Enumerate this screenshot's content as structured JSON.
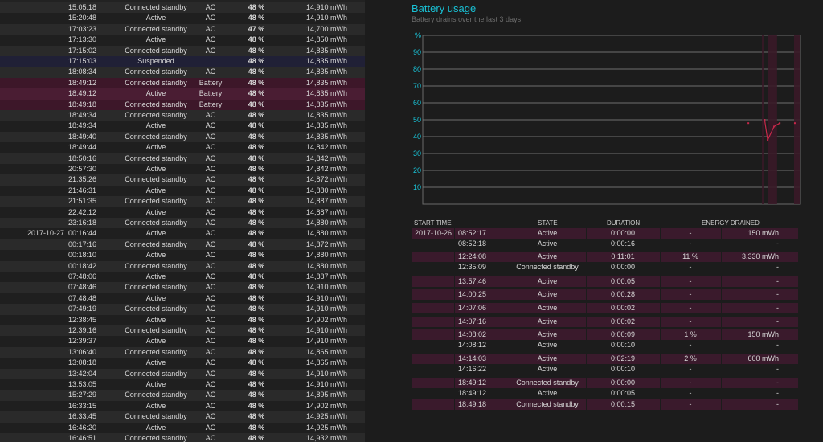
{
  "log": [
    {
      "date": "",
      "time": "15:05:18",
      "state": "Connected standby",
      "source": "AC",
      "pct": "48 %",
      "cap": "14,910 mWh"
    },
    {
      "date": "",
      "time": "15:20:48",
      "state": "Active",
      "source": "AC",
      "pct": "48 %",
      "cap": "14,910 mWh"
    },
    {
      "date": "",
      "time": "17:03:23",
      "state": "Connected standby",
      "source": "AC",
      "pct": "47 %",
      "cap": "14,700 mWh"
    },
    {
      "date": "",
      "time": "17:13:30",
      "state": "Active",
      "source": "AC",
      "pct": "48 %",
      "cap": "14,850 mWh"
    },
    {
      "date": "",
      "time": "17:15:02",
      "state": "Connected standby",
      "source": "AC",
      "pct": "48 %",
      "cap": "14,835 mWh"
    },
    {
      "date": "",
      "time": "17:15:03",
      "state": "Suspended",
      "source": "",
      "pct": "48 %",
      "cap": "14,835 mWh"
    },
    {
      "date": "",
      "time": "18:08:34",
      "state": "Connected standby",
      "source": "AC",
      "pct": "48 %",
      "cap": "14,835 mWh"
    },
    {
      "date": "",
      "time": "18:49:12",
      "state": "Connected standby",
      "source": "Battery",
      "pct": "48 %",
      "cap": "14,835 mWh"
    },
    {
      "date": "",
      "time": "18:49:12",
      "state": "Active",
      "source": "Battery",
      "pct": "48 %",
      "cap": "14,835 mWh"
    },
    {
      "date": "",
      "time": "18:49:18",
      "state": "Connected standby",
      "source": "Battery",
      "pct": "48 %",
      "cap": "14,835 mWh"
    },
    {
      "date": "",
      "time": "18:49:34",
      "state": "Connected standby",
      "source": "AC",
      "pct": "48 %",
      "cap": "14,835 mWh"
    },
    {
      "date": "",
      "time": "18:49:34",
      "state": "Active",
      "source": "AC",
      "pct": "48 %",
      "cap": "14,835 mWh"
    },
    {
      "date": "",
      "time": "18:49:40",
      "state": "Connected standby",
      "source": "AC",
      "pct": "48 %",
      "cap": "14,835 mWh"
    },
    {
      "date": "",
      "time": "18:49:44",
      "state": "Active",
      "source": "AC",
      "pct": "48 %",
      "cap": "14,842 mWh"
    },
    {
      "date": "",
      "time": "18:50:16",
      "state": "Connected standby",
      "source": "AC",
      "pct": "48 %",
      "cap": "14,842 mWh"
    },
    {
      "date": "",
      "time": "20:57:30",
      "state": "Active",
      "source": "AC",
      "pct": "48 %",
      "cap": "14,842 mWh"
    },
    {
      "date": "",
      "time": "21:35:26",
      "state": "Connected standby",
      "source": "AC",
      "pct": "48 %",
      "cap": "14,872 mWh"
    },
    {
      "date": "",
      "time": "21:46:31",
      "state": "Active",
      "source": "AC",
      "pct": "48 %",
      "cap": "14,880 mWh"
    },
    {
      "date": "",
      "time": "21:51:35",
      "state": "Connected standby",
      "source": "AC",
      "pct": "48 %",
      "cap": "14,887 mWh"
    },
    {
      "date": "",
      "time": "22:42:12",
      "state": "Active",
      "source": "AC",
      "pct": "48 %",
      "cap": "14,887 mWh"
    },
    {
      "date": "",
      "time": "23:16:18",
      "state": "Connected standby",
      "source": "AC",
      "pct": "48 %",
      "cap": "14,880 mWh"
    },
    {
      "date": "2017-10-27",
      "time": "00:16:44",
      "state": "Active",
      "source": "AC",
      "pct": "48 %",
      "cap": "14,880 mWh"
    },
    {
      "date": "",
      "time": "00:17:16",
      "state": "Connected standby",
      "source": "AC",
      "pct": "48 %",
      "cap": "14,872 mWh"
    },
    {
      "date": "",
      "time": "00:18:10",
      "state": "Active",
      "source": "AC",
      "pct": "48 %",
      "cap": "14,880 mWh"
    },
    {
      "date": "",
      "time": "00:18:42",
      "state": "Connected standby",
      "source": "AC",
      "pct": "48 %",
      "cap": "14,880 mWh"
    },
    {
      "date": "",
      "time": "07:48:06",
      "state": "Active",
      "source": "AC",
      "pct": "48 %",
      "cap": "14,887 mWh"
    },
    {
      "date": "",
      "time": "07:48:46",
      "state": "Connected standby",
      "source": "AC",
      "pct": "48 %",
      "cap": "14,910 mWh"
    },
    {
      "date": "",
      "time": "07:48:48",
      "state": "Active",
      "source": "AC",
      "pct": "48 %",
      "cap": "14,910 mWh"
    },
    {
      "date": "",
      "time": "07:49:19",
      "state": "Connected standby",
      "source": "AC",
      "pct": "48 %",
      "cap": "14,910 mWh"
    },
    {
      "date": "",
      "time": "12:38:45",
      "state": "Active",
      "source": "AC",
      "pct": "48 %",
      "cap": "14,902 mWh"
    },
    {
      "date": "",
      "time": "12:39:16",
      "state": "Connected standby",
      "source": "AC",
      "pct": "48 %",
      "cap": "14,910 mWh"
    },
    {
      "date": "",
      "time": "12:39:37",
      "state": "Active",
      "source": "AC",
      "pct": "48 %",
      "cap": "14,910 mWh"
    },
    {
      "date": "",
      "time": "13:06:40",
      "state": "Connected standby",
      "source": "AC",
      "pct": "48 %",
      "cap": "14,865 mWh"
    },
    {
      "date": "",
      "time": "13:08:18",
      "state": "Active",
      "source": "AC",
      "pct": "48 %",
      "cap": "14,865 mWh"
    },
    {
      "date": "",
      "time": "13:42:04",
      "state": "Connected standby",
      "source": "AC",
      "pct": "48 %",
      "cap": "14,910 mWh"
    },
    {
      "date": "",
      "time": "13:53:05",
      "state": "Active",
      "source": "AC",
      "pct": "48 %",
      "cap": "14,910 mWh"
    },
    {
      "date": "",
      "time": "15:27:29",
      "state": "Connected standby",
      "source": "AC",
      "pct": "48 %",
      "cap": "14,895 mWh"
    },
    {
      "date": "",
      "time": "16:33:15",
      "state": "Active",
      "source": "AC",
      "pct": "48 %",
      "cap": "14,902 mWh"
    },
    {
      "date": "",
      "time": "16:33:45",
      "state": "Connected standby",
      "source": "AC",
      "pct": "48 %",
      "cap": "14,925 mWh"
    },
    {
      "date": "",
      "time": "16:46:20",
      "state": "Active",
      "source": "AC",
      "pct": "48 %",
      "cap": "14,925 mWh"
    },
    {
      "date": "",
      "time": "16:46:51",
      "state": "Connected standby",
      "source": "AC",
      "pct": "48 %",
      "cap": "14,932 mWh"
    }
  ],
  "battery_usage": {
    "title": "Battery usage",
    "subtitle": "Battery drains over the last 3 days",
    "colors": {
      "accent": "#19c0d4",
      "drain": "#c8284a",
      "row_bg": "#3a1a2c"
    },
    "columns": {
      "start_time": "START TIME",
      "state": "STATE",
      "duration": "DURATION",
      "energy_drained": "ENERGY DRAINED"
    },
    "rows": [
      {
        "date": "2017-10-26",
        "time": "08:52:17",
        "state": "Active",
        "duration": "0:00:00",
        "pct": "-",
        "mwh": "150 mWh"
      },
      {
        "date": "",
        "time": "08:52:18",
        "state": "Active",
        "duration": "0:00:16",
        "pct": "-",
        "mwh": "-"
      },
      {
        "date": "",
        "time": "12:24:08",
        "state": "Active",
        "duration": "0:11:01",
        "pct": "11 %",
        "mwh": "3,330 mWh"
      },
      {
        "date": "",
        "time": "12:35:09",
        "state": "Connected standby",
        "duration": "0:00:00",
        "pct": "-",
        "mwh": "-"
      },
      {
        "date": "",
        "time": "13:57:46",
        "state": "Active",
        "duration": "0:00:05",
        "pct": "-",
        "mwh": "-"
      },
      {
        "date": "",
        "time": "14:00:25",
        "state": "Active",
        "duration": "0:00:28",
        "pct": "-",
        "mwh": "-"
      },
      {
        "date": "",
        "time": "14:07:06",
        "state": "Active",
        "duration": "0:00:02",
        "pct": "-",
        "mwh": "-"
      },
      {
        "date": "",
        "time": "14:07:16",
        "state": "Active",
        "duration": "0:00:02",
        "pct": "-",
        "mwh": "-"
      },
      {
        "date": "",
        "time": "14:08:02",
        "state": "Active",
        "duration": "0:00:09",
        "pct": "1 %",
        "mwh": "150 mWh"
      },
      {
        "date": "",
        "time": "14:08:12",
        "state": "Active",
        "duration": "0:00:10",
        "pct": "-",
        "mwh": "-"
      },
      {
        "date": "",
        "time": "14:14:03",
        "state": "Active",
        "duration": "0:02:19",
        "pct": "2 %",
        "mwh": "600 mWh"
      },
      {
        "date": "",
        "time": "14:16:22",
        "state": "Active",
        "duration": "0:00:10",
        "pct": "-",
        "mwh": "-"
      },
      {
        "date": "",
        "time": "18:49:12",
        "state": "Connected standby",
        "duration": "0:00:00",
        "pct": "-",
        "mwh": "-"
      },
      {
        "date": "",
        "time": "18:49:12",
        "state": "Active",
        "duration": "0:00:05",
        "pct": "-",
        "mwh": "-"
      },
      {
        "date": "",
        "time": "18:49:18",
        "state": "Connected standby",
        "duration": "0:00:15",
        "pct": "-",
        "mwh": "-"
      }
    ]
  },
  "chart_data": {
    "type": "line",
    "y_unit": "%",
    "y_ticks": [
      10,
      20,
      30,
      40,
      50,
      60,
      70,
      80,
      90
    ],
    "ylim": [
      0,
      100
    ],
    "grid": true,
    "drain_series": [
      {
        "x": 0.862,
        "y": 48
      },
      {
        "x": 0.905,
        "y": 50
      },
      {
        "x": 0.913,
        "y": 38
      },
      {
        "x": 0.93,
        "y": 46
      },
      {
        "x": 0.945,
        "y": 48
      },
      {
        "x": 0.985,
        "y": 48
      }
    ]
  }
}
